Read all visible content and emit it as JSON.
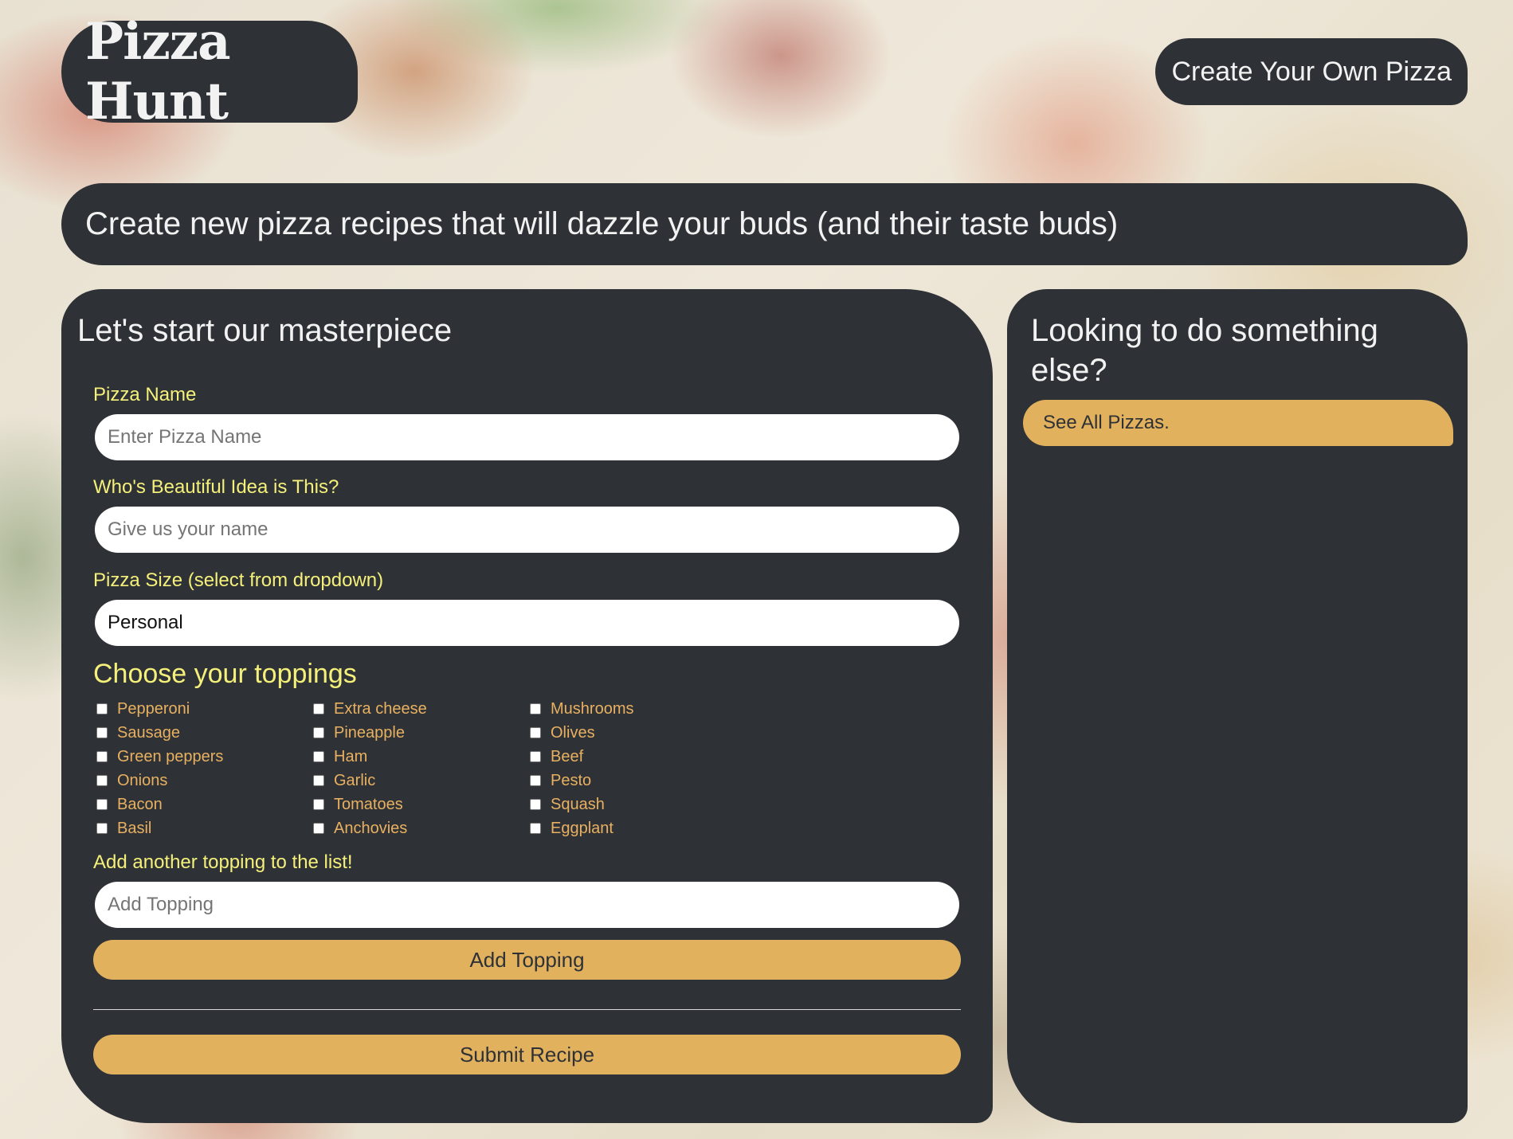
{
  "header": {
    "logo_text": "Pizza Hunt",
    "create_button": "Create Your Own Pizza"
  },
  "banner": {
    "text": "Create new pizza recipes that will dazzle your buds (and their taste buds)"
  },
  "form": {
    "title": "Let's start our masterpiece",
    "pizza_name_label": "Pizza Name",
    "pizza_name_placeholder": "Enter Pizza Name",
    "author_label": "Who's Beautiful Idea is This?",
    "author_placeholder": "Give us your name",
    "size_label": "Pizza Size (select from dropdown)",
    "size_selected": "Personal",
    "toppings_heading": "Choose your toppings",
    "toppings": [
      "Pepperoni",
      "Extra cheese",
      "Mushrooms",
      "Sausage",
      "Pineapple",
      "Olives",
      "Green peppers",
      "Ham",
      "Beef",
      "Onions",
      "Garlic",
      "Pesto",
      "Bacon",
      "Tomatoes",
      "Squash",
      "Basil",
      "Anchovies",
      "Eggplant"
    ],
    "add_topping_label": "Add another topping to the list!",
    "add_topping_placeholder": "Add Topping",
    "add_topping_button": "Add Topping",
    "submit_button": "Submit Recipe"
  },
  "sidebar": {
    "title": "Looking to do something else?",
    "see_all_link": "See All Pizzas."
  },
  "colors": {
    "panel": "#2e3236",
    "accent_gold": "#e2b15e",
    "label_yellow": "#f5f07a",
    "topping_text": "#e8b060"
  }
}
